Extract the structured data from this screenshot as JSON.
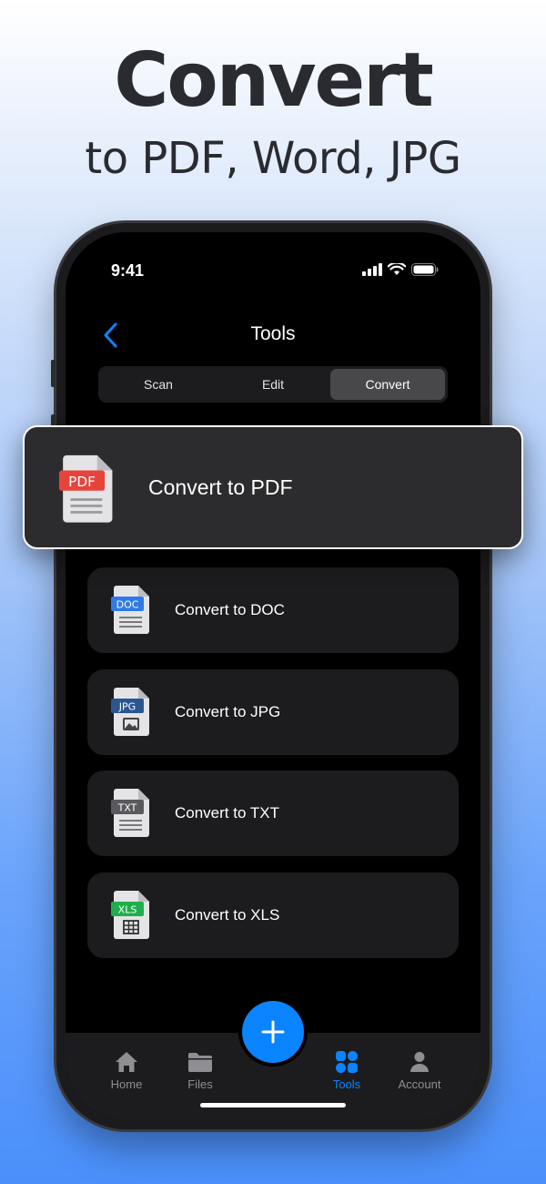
{
  "hero": {
    "title": "Convert",
    "subtitle": "to PDF, Word, JPG"
  },
  "status_bar": {
    "time": "9:41"
  },
  "nav": {
    "title": "Tools",
    "back_icon": "chevron-left-icon"
  },
  "segmented": {
    "tabs": [
      "Scan",
      "Edit",
      "Convert"
    ],
    "selected": "Convert"
  },
  "featured": {
    "label": "Convert to PDF",
    "badge": "PDF",
    "badge_color": "#e8433b",
    "icon": "pdf-file-icon"
  },
  "items": [
    {
      "label": "Convert to DOC",
      "badge": "DOC",
      "badge_color": "#2f7ae5",
      "icon": "doc-file-icon"
    },
    {
      "label": "Convert to JPG",
      "badge": "JPG",
      "badge_color": "#2b5692",
      "icon": "jpg-file-icon"
    },
    {
      "label": "Convert to TXT",
      "badge": "TXT",
      "badge_color": "#5a5a5e",
      "icon": "txt-file-icon"
    },
    {
      "label": "Convert to XLS",
      "badge": "XLS",
      "badge_color": "#1fae4c",
      "icon": "xls-file-icon"
    }
  ],
  "tabbar": {
    "tabs": [
      {
        "label": "Home",
        "icon": "home-icon"
      },
      {
        "label": "Files",
        "icon": "folder-icon"
      },
      {
        "label": "Tools",
        "icon": "grid-icon",
        "active": true
      },
      {
        "label": "Account",
        "icon": "person-icon"
      }
    ],
    "fab_icon": "plus-icon"
  },
  "colors": {
    "accent": "#0a84ff",
    "screen_bg": "#000000",
    "card_bg": "#1c1c1e"
  }
}
